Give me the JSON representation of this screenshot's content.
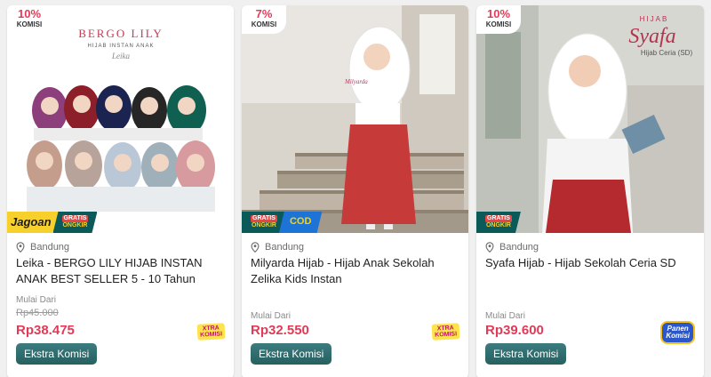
{
  "products": [
    {
      "komisi_pct": "10%",
      "komisi_label": "KOMISI",
      "image_brand": "BERGO LILY",
      "image_tagline": "HIJAB INSTAN ANAK",
      "image_sign": "Leika",
      "badge_jagoan": "Jagoan",
      "badge_gratis_line1": "GRATIS",
      "badge_gratis_line2": "ONGKIR",
      "location": "Bandung",
      "title": "Leika - BERGO LILY HIJAB INSTAN ANAK BEST SELLER 5 - 10 Tahun",
      "price_label": "Mulai Dari",
      "original_price": "Rp45.000",
      "price": "Rp38.475",
      "logo_line1": "XTRA",
      "logo_line2": "KOMISI",
      "button": "Ekstra Komisi"
    },
    {
      "komisi_pct": "7%",
      "komisi_label": "KOMISI",
      "image_brand": "Milyarda",
      "badge_gratis_line1": "GRATIS",
      "badge_gratis_line2": "ONGKIR",
      "badge_cod": "COD",
      "location": "Bandung",
      "title": "Milyarda Hijab - Hijab Anak Sekolah Zelika Kids Instan",
      "price_label": "Mulai Dari",
      "price": "Rp32.550",
      "logo_line1": "XTRA",
      "logo_line2": "KOMISI",
      "button": "Ekstra Komisi"
    },
    {
      "komisi_pct": "10%",
      "komisi_label": "KOMISI",
      "image_brand_small": "HIJAB",
      "image_brand": "Syafa",
      "image_caption": "Hijab Ceria (SD)",
      "badge_gratis_line1": "GRATIS",
      "badge_gratis_line2": "ONGKIR",
      "location": "Bandung",
      "title": "Syafa Hijab - Hijab Sekolah Ceria SD",
      "price_label": "Mulai Dari",
      "price": "Rp39.600",
      "logo_line1": "Panen",
      "logo_line2": "Komisi",
      "button": "Ekstra Komisi"
    }
  ],
  "colors": {
    "price": "#e23a57",
    "button": "#2f6c70",
    "gratis_badge": "#0a5a5a",
    "jagoan_badge": "#f7d02b",
    "cod_badge": "#1e74d6"
  },
  "icons": [
    "location-pin-icon"
  ]
}
